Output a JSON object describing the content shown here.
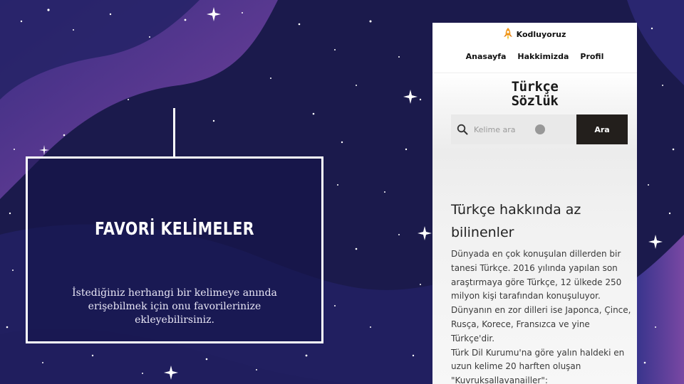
{
  "colors": {
    "background": "#1c1a4e",
    "wave_purple": "#6a3f98",
    "card_border": "#ffffff",
    "button_dark": "#231f1c"
  },
  "left_card": {
    "title": "FAVORİ KELİMELER",
    "description": "İstediğiniz herhangi bir kelimeye anında erişebilmek için onu favorilerinize ekleyebilirsiniz."
  },
  "phone": {
    "brand": {
      "name": "Kodluyoruz",
      "icon": "rocket-icon"
    },
    "nav": [
      {
        "label": "Anasayfa"
      },
      {
        "label": "Hakkimizda"
      },
      {
        "label": "Profil"
      }
    ],
    "logo_line1": "Türkçe",
    "logo_line2": "Sözlük",
    "search": {
      "placeholder": "Kelime ara",
      "icon": "search-icon",
      "button_label": "Ara"
    },
    "section_title": "Türkçe hakkında az bilinenler",
    "section_body": "Dünyada en çok konuşulan dillerden bir tanesi Türkçe. 2016 yılında yapılan son araştırmaya göre Türkçe, 12 ülkede 250 milyon kişi tarafından konuşuluyor. Dünyanın en zor dilleri ise Japonca, Çince, Rusça, Korece, Fransızca ve yine Türkçe'dir.\nTürk Dil Kurumu'na göre yalın haldeki en uzun kelime 20 harften oluşan \"Kuvruksallavanailler\":"
  }
}
